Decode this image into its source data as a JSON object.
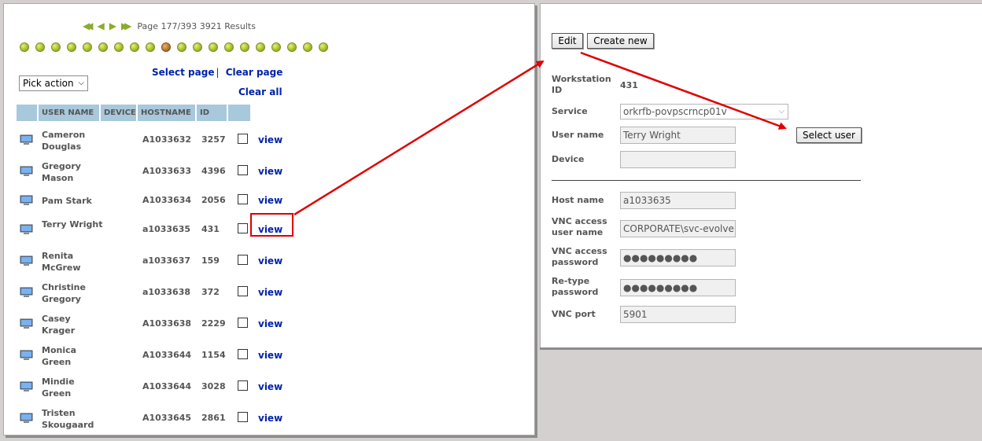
{
  "pager": {
    "text": "Page 177/393 3921 Results",
    "first_icon": "first-page-icon",
    "prev_icon": "prev-page-icon",
    "next_icon": "next-page-icon",
    "last_icon": "last-page-icon",
    "dot_count": 20,
    "active_dot": 9
  },
  "actions": {
    "pick_action": "Pick action",
    "select_page": "Select page",
    "separator": "|",
    "clear_page": "Clear page",
    "clear_all": "Clear all"
  },
  "table": {
    "headers": [
      "",
      "USER NAME",
      "DEVICE",
      "HOSTNAME",
      "ID",
      ""
    ],
    "rows": [
      {
        "user": "Cameron Douglas",
        "device": "",
        "host": "A1033632",
        "id": "3257",
        "link": "view"
      },
      {
        "user": "Gregory Mason",
        "device": "",
        "host": "A1033633",
        "id": "4396",
        "link": "view"
      },
      {
        "user": "Pam Stark",
        "device": "",
        "host": "A1033634",
        "id": "2056",
        "link": "view"
      },
      {
        "user": "Terry Wright",
        "device": "",
        "host": "a1033635",
        "id": "431",
        "link": "view"
      },
      {
        "user": "Renita McGrew",
        "device": "",
        "host": "a1033637",
        "id": "159",
        "link": "view"
      },
      {
        "user": "Christine Gregory",
        "device": "",
        "host": "a1033638",
        "id": "372",
        "link": "view"
      },
      {
        "user": "Casey Krager",
        "device": "",
        "host": "A1033638",
        "id": "2229",
        "link": "view"
      },
      {
        "user": "Monica Green",
        "device": "",
        "host": "A1033644",
        "id": "1154",
        "link": "view"
      },
      {
        "user": "Mindie Green",
        "device": "",
        "host": "A1033644",
        "id": "3028",
        "link": "view"
      },
      {
        "user": "Tristen Skougaard",
        "device": "",
        "host": "A1033645",
        "id": "2861",
        "link": "view"
      }
    ]
  },
  "detail": {
    "edit_label": "Edit",
    "create_label": "Create new",
    "workstation_label": "Workstation ID",
    "workstation_value": "431",
    "service_label": "Service",
    "service_value": "orkrfb-povpscrncp01v",
    "username_label": "User name",
    "username_value": "Terry Wright",
    "select_user_label": "Select user",
    "device_label": "Device",
    "device_value": "",
    "hostname_label": "Host name",
    "hostname_value": "a1033635",
    "vnc_user_label": "VNC access user name",
    "vnc_user_value": "CORPORATE\\svc-evolveip",
    "vnc_pass_label": "VNC access password",
    "vnc_pass_value": "●●●●●●●●●",
    "retype_label": "Re-type password",
    "retype_value": "●●●●●●●●●",
    "port_label": "VNC port",
    "port_value": "5901"
  },
  "colors": {
    "link": "#0022aa",
    "header_bg": "#a8c8dc",
    "annotation": "#e00000"
  }
}
